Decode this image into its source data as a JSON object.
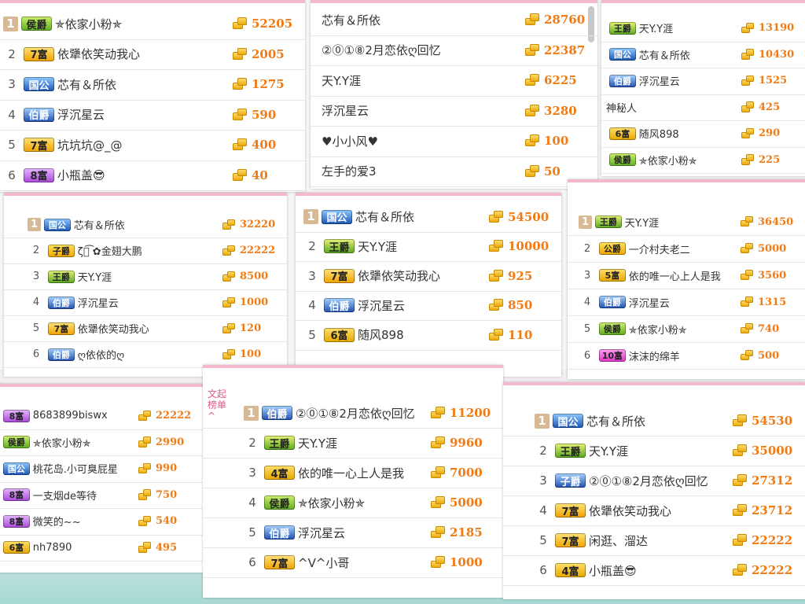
{
  "panels": {
    "p1": {
      "rows": [
        {
          "rank": "1",
          "badge": "侯爵",
          "bclass": "b-hou",
          "name": "✯依家小粉✯",
          "value": "52205"
        },
        {
          "rank": "2",
          "badge": "7富",
          "bclass": "b-fu7",
          "name": "依犟依笑动我心",
          "value": "2005"
        },
        {
          "rank": "3",
          "badge": "国公",
          "bclass": "b-gong",
          "name": "芯有＆所依",
          "value": "1275"
        },
        {
          "rank": "4",
          "badge": "伯爵",
          "bclass": "b-bo",
          "name": "浮沉星云",
          "value": "590"
        },
        {
          "rank": "5",
          "badge": "7富",
          "bclass": "b-fu7",
          "name": "坑坑坑@_@",
          "value": "400"
        },
        {
          "rank": "6",
          "badge": "8富",
          "bclass": "b-fu8",
          "name": "小瓶盖😎",
          "value": "40"
        }
      ]
    },
    "p2": {
      "rows": [
        {
          "rank": "",
          "badge": "",
          "bclass": "",
          "name": "芯有＆所依",
          "value": "28760"
        },
        {
          "rank": "",
          "badge": "",
          "bclass": "",
          "name": "②⓪①⑧2月恋依ღ回忆",
          "value": "22387"
        },
        {
          "rank": "",
          "badge": "",
          "bclass": "",
          "name": "天Y.Y涯",
          "value": "6225"
        },
        {
          "rank": "",
          "badge": "",
          "bclass": "",
          "name": "浮沉星云",
          "value": "3280"
        },
        {
          "rank": "",
          "badge": "",
          "bclass": "",
          "name": "♥小小风♥",
          "value": "100"
        },
        {
          "rank": "",
          "badge": "",
          "bclass": "",
          "name": "左手的爱3",
          "value": "50"
        }
      ]
    },
    "p3": {
      "rows": [
        {
          "rank": "",
          "badge": "王爵",
          "bclass": "b-wang",
          "name": "天Y.Y涯",
          "value": "13190"
        },
        {
          "rank": "",
          "badge": "国公",
          "bclass": "b-gong",
          "name": "芯有＆所依",
          "value": "10430"
        },
        {
          "rank": "",
          "badge": "伯爵",
          "bclass": "b-bo",
          "name": "浮沉星云",
          "value": "1525"
        },
        {
          "rank": "",
          "badge": "",
          "bclass": "",
          "name": "神秘人",
          "value": "425"
        },
        {
          "rank": "",
          "badge": "6富",
          "bclass": "b-fu6",
          "name": "随风898",
          "value": "290"
        },
        {
          "rank": "",
          "badge": "侯爵",
          "bclass": "b-hou",
          "name": "✯依家小粉✯",
          "value": "225"
        }
      ]
    },
    "p4": {
      "rows": [
        {
          "rank": "1",
          "badge": "国公",
          "bclass": "b-gong",
          "name": "芯有＆所依",
          "value": "32220"
        },
        {
          "rank": "2",
          "badge": "子爵",
          "bclass": "b-zi",
          "name": "ζั͡ ✿金翅大鹏",
          "value": "22222"
        },
        {
          "rank": "3",
          "badge": "王爵",
          "bclass": "b-wang",
          "name": "天Y.Y涯",
          "value": "8500"
        },
        {
          "rank": "4",
          "badge": "伯爵",
          "bclass": "b-bo",
          "name": "浮沉星云",
          "value": "1000"
        },
        {
          "rank": "5",
          "badge": "7富",
          "bclass": "b-fu7",
          "name": "依犟依笑动我心",
          "value": "120"
        },
        {
          "rank": "6",
          "badge": "伯爵",
          "bclass": "b-bo",
          "name": "ღ依依的ღ",
          "value": "100"
        }
      ]
    },
    "p5": {
      "rows": [
        {
          "rank": "1",
          "badge": "国公",
          "bclass": "b-gong",
          "name": "芯有＆所依",
          "value": "54500"
        },
        {
          "rank": "2",
          "badge": "王爵",
          "bclass": "b-wang",
          "name": "天Y.Y涯",
          "value": "10000"
        },
        {
          "rank": "3",
          "badge": "7富",
          "bclass": "b-fu7",
          "name": "依犟依笑动我心",
          "value": "925"
        },
        {
          "rank": "4",
          "badge": "伯爵",
          "bclass": "b-bo",
          "name": "浮沉星云",
          "value": "850"
        },
        {
          "rank": "5",
          "badge": "6富",
          "bclass": "b-fu6",
          "name": "随风898",
          "value": "110"
        }
      ]
    },
    "p6": {
      "rows": [
        {
          "rank": "1",
          "badge": "王爵",
          "bclass": "b-wang",
          "name": "天Y.Y涯",
          "value": "36450"
        },
        {
          "rank": "2",
          "badge": "公爵",
          "bclass": "b-zi",
          "name": "一介村夫老二",
          "value": "5000"
        },
        {
          "rank": "3",
          "badge": "5富",
          "bclass": "b-fu5",
          "name": "依的唯一心上人是我",
          "value": "3560"
        },
        {
          "rank": "4",
          "badge": "伯爵",
          "bclass": "b-bo",
          "name": "浮沉星云",
          "value": "1315"
        },
        {
          "rank": "5",
          "badge": "侯爵",
          "bclass": "b-hou",
          "name": "✯依家小粉✯",
          "value": "740"
        },
        {
          "rank": "6",
          "badge": "10富",
          "bclass": "b-fu10",
          "name": "沫沫的绵羊",
          "value": "500"
        }
      ]
    },
    "p7": {
      "rows": [
        {
          "rank": "",
          "badge": "8富",
          "bclass": "b-fu8",
          "name": "8683899biswx",
          "value": "22222"
        },
        {
          "rank": "",
          "badge": "侯爵",
          "bclass": "b-hou",
          "name": "✯依家小粉✯",
          "value": "2990"
        },
        {
          "rank": "",
          "badge": "国公",
          "bclass": "b-gong",
          "name": "桃花岛.小可臭屁星",
          "value": "990"
        },
        {
          "rank": "",
          "badge": "8富",
          "bclass": "b-fu8",
          "name": "一支烟de等待",
          "value": "750"
        },
        {
          "rank": "",
          "badge": "8富",
          "bclass": "b-fu8",
          "name": "微笑的~~",
          "value": "540"
        },
        {
          "rank": "",
          "badge": "6富",
          "bclass": "b-fu6",
          "name": "nh7890",
          "value": "495"
        }
      ]
    },
    "p8": {
      "side": "文起\n榜单\n^",
      "rows": [
        {
          "rank": "1",
          "badge": "伯爵",
          "bclass": "b-bo",
          "name": "②⓪①⑧2月恋依ღ回忆",
          "value": "11200"
        },
        {
          "rank": "2",
          "badge": "王爵",
          "bclass": "b-wang",
          "name": "天Y.Y涯",
          "value": "9960"
        },
        {
          "rank": "3",
          "badge": "4富",
          "bclass": "b-fu4",
          "name": "依的唯一心上人是我",
          "value": "7000"
        },
        {
          "rank": "4",
          "badge": "侯爵",
          "bclass": "b-hou",
          "name": "✯依家小粉✯",
          "value": "5000"
        },
        {
          "rank": "5",
          "badge": "伯爵",
          "bclass": "b-bo",
          "name": "浮沉星云",
          "value": "2185"
        },
        {
          "rank": "6",
          "badge": "7富",
          "bclass": "b-fu7",
          "name": "^V^小哥",
          "value": "1000"
        }
      ]
    },
    "p9": {
      "rows": [
        {
          "rank": "1",
          "badge": "国公",
          "bclass": "b-gong",
          "name": "芯有＆所依",
          "value": "54530"
        },
        {
          "rank": "2",
          "badge": "王爵",
          "bclass": "b-wang",
          "name": "天Y.Y涯",
          "value": "35000"
        },
        {
          "rank": "3",
          "badge": "子爵",
          "bclass": "b-bo",
          "name": "②⓪①⑧2月恋依ღ回忆",
          "value": "27312"
        },
        {
          "rank": "4",
          "badge": "7富",
          "bclass": "b-fu7",
          "name": "依犟依笑动我心",
          "value": "23712"
        },
        {
          "rank": "5",
          "badge": "7富",
          "bclass": "b-fu7",
          "name": "闲逛、溜达",
          "value": "22222"
        },
        {
          "rank": "6",
          "badge": "4富",
          "bclass": "b-fu4",
          "name": "小瓶盖😎",
          "value": "22222"
        }
      ]
    }
  }
}
